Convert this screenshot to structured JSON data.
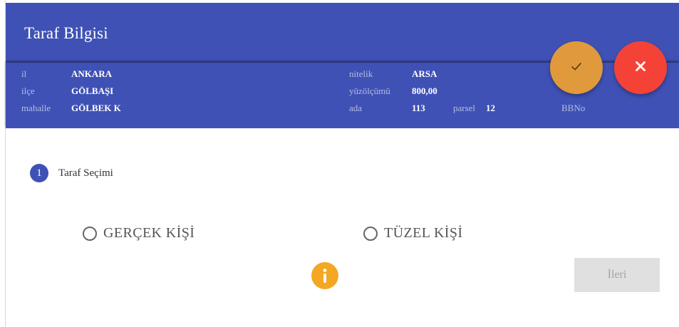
{
  "dialog": {
    "title": "Taraf Bilgisi"
  },
  "parcel_info": {
    "il_label": "il",
    "il_value": "ANKARA",
    "ilce_label": "ilçe",
    "ilce_value": "GÖLBAŞI",
    "mahalle_label": "mahalle",
    "mahalle_value": "GÖLBEK K",
    "nitelik_label": "nitelik",
    "nitelik_value": "ARSA",
    "yuzolcumu_label": "yüzölçümü",
    "yuzolcumu_value": "800,00",
    "ada_label": "ada",
    "ada_value": "113",
    "parsel_label": "parsel",
    "parsel_value": "12",
    "bbno_label": "BBNo"
  },
  "actions": {
    "confirm_icon": "check-icon",
    "close_icon": "close-icon"
  },
  "step": {
    "number": "1",
    "label": "Taraf Seçimi"
  },
  "options": {
    "gercek": "GERÇEK KİŞİ",
    "tuzel": "TÜZEL KİŞİ"
  },
  "footer": {
    "info_icon": "info-icon",
    "next_label": "İleri"
  },
  "colors": {
    "header": "#3f51b5",
    "confirm": "#e09a3c",
    "close": "#f44336",
    "info": "#f5a623",
    "button_disabled": "#e0e0e0"
  }
}
